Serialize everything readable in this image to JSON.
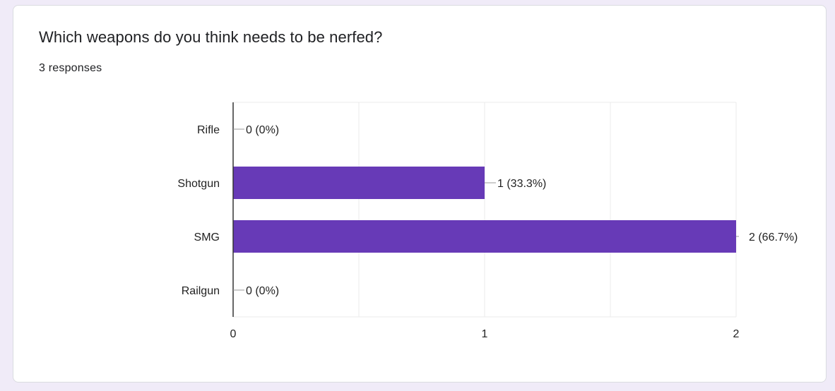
{
  "question": {
    "title": "Which weapons do you think needs to be nerfed?",
    "responses": "3 responses"
  },
  "colors": {
    "bar": "#673ab7",
    "grid": "#ebebeb",
    "axis": "#333333",
    "text": "#222222",
    "background": "#f0ebf8"
  },
  "chart_data": {
    "type": "bar",
    "orientation": "horizontal",
    "categories": [
      "Rifle",
      "Shotgun",
      "SMG",
      "Railgun"
    ],
    "values": [
      0,
      1,
      2,
      0
    ],
    "data_labels": [
      "0 (0%)",
      "1 (33.3%)",
      "2 (66.7%)",
      "0 (0%)"
    ],
    "x_ticks": [
      "0",
      "1",
      "2"
    ],
    "xlim": [
      0,
      2
    ],
    "grid": true,
    "title": "",
    "xlabel": "",
    "ylabel": ""
  }
}
